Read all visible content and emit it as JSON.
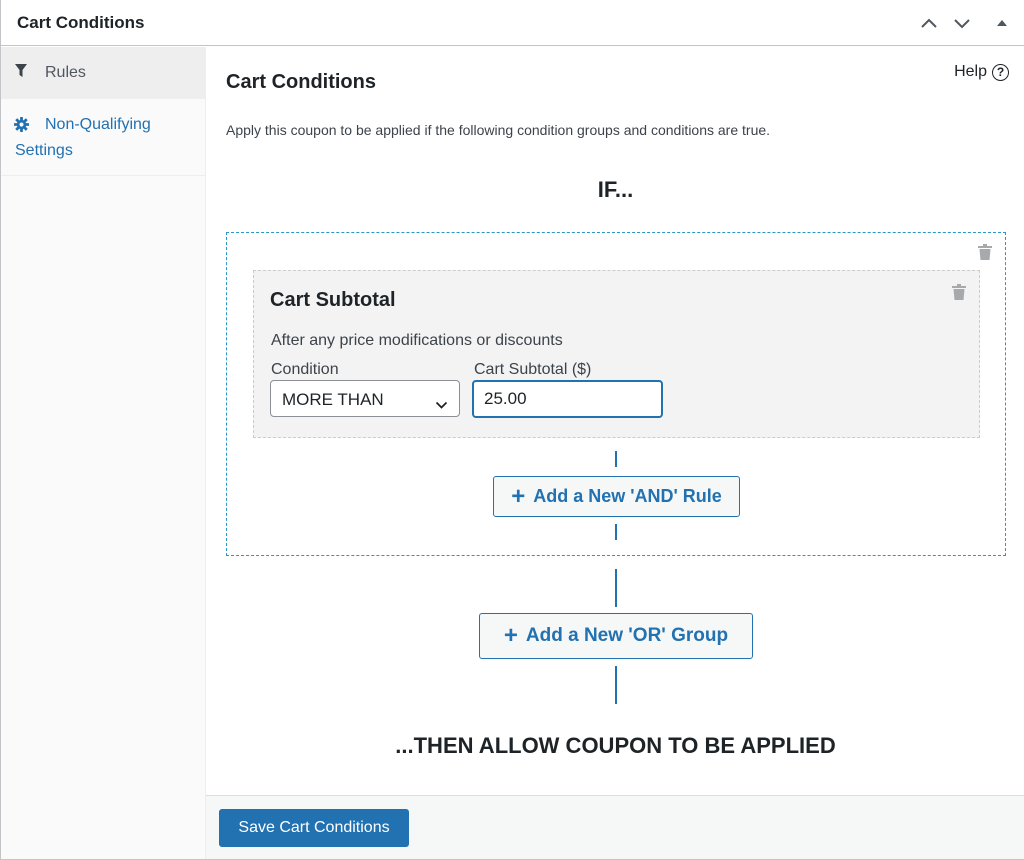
{
  "panel": {
    "title": "Cart Conditions",
    "controls": {
      "move_up_label": "Move up",
      "move_down_label": "Move down",
      "toggle_label": "Toggle panel"
    }
  },
  "sidebar": {
    "items": [
      {
        "label": "Rules",
        "icon": "filter-icon",
        "active": true
      },
      {
        "label_line1": "Non-Qualifying",
        "label_line2": "Settings",
        "icon": "gear-icon",
        "active": false
      }
    ]
  },
  "main": {
    "title": "Cart Conditions",
    "help_label": "Help",
    "help_icon": "?",
    "description": "Apply this coupon to be applied if the following condition groups and conditions are true.",
    "if_label": "IF...",
    "then_label": "...THEN ALLOW COUPON TO BE APPLIED",
    "groups": [
      {
        "conditions": [
          {
            "title": "Cart Subtotal",
            "description": "After any price modifications or discounts",
            "condition_label": "Condition",
            "condition_value": "MORE THAN",
            "subtotal_label": "Cart Subtotal ($)",
            "subtotal_value": "25.00"
          }
        ],
        "add_and_label": "Add a New 'AND' Rule"
      }
    ],
    "add_or_label": "Add a New 'OR' Group"
  },
  "footer": {
    "save_label": "Save Cart Conditions"
  },
  "colors": {
    "accent": "#2271b1",
    "group_border": "#2a97c8",
    "text": "#1d2327",
    "muted_icon": "#a7aaad"
  }
}
